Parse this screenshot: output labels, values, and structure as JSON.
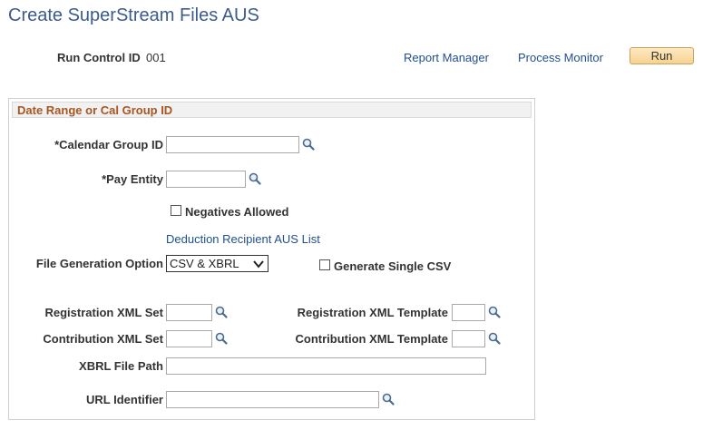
{
  "page": {
    "title": "Create SuperStream Files AUS"
  },
  "run_control": {
    "label": "Run Control ID",
    "value": "001"
  },
  "links": {
    "report_manager": "Report Manager",
    "process_monitor": "Process Monitor"
  },
  "run_button": {
    "label": "Run"
  },
  "group": {
    "title": "Date Range or Cal Group ID",
    "calendar_group": {
      "label": "*Calendar Group ID",
      "value": ""
    },
    "pay_entity": {
      "label": "*Pay Entity",
      "value": ""
    },
    "negatives_allowed": {
      "label": "Negatives Allowed",
      "checked": false
    },
    "deduction_link": "Deduction Recipient AUS List",
    "file_generation": {
      "label": "File Generation Option",
      "selected": "CSV & XBRL"
    },
    "generate_single_csv": {
      "label": "Generate Single CSV",
      "checked": false
    },
    "registration_xml_set": {
      "label": "Registration XML Set",
      "value": ""
    },
    "registration_xml_template": {
      "label": "Registration XML Template",
      "value": ""
    },
    "contribution_xml_set": {
      "label": "Contribution XML Set",
      "value": ""
    },
    "contribution_xml_template": {
      "label": "Contribution XML Template",
      "value": ""
    },
    "xbrl_file_path": {
      "label": "XBRL File Path",
      "value": ""
    },
    "url_identifier": {
      "label": "URL Identifier",
      "value": ""
    }
  },
  "icons": {
    "lookup": "magnifier-lookup-icon",
    "dropdown": "chevron-down-icon",
    "checkbox": "checkbox-unchecked"
  }
}
